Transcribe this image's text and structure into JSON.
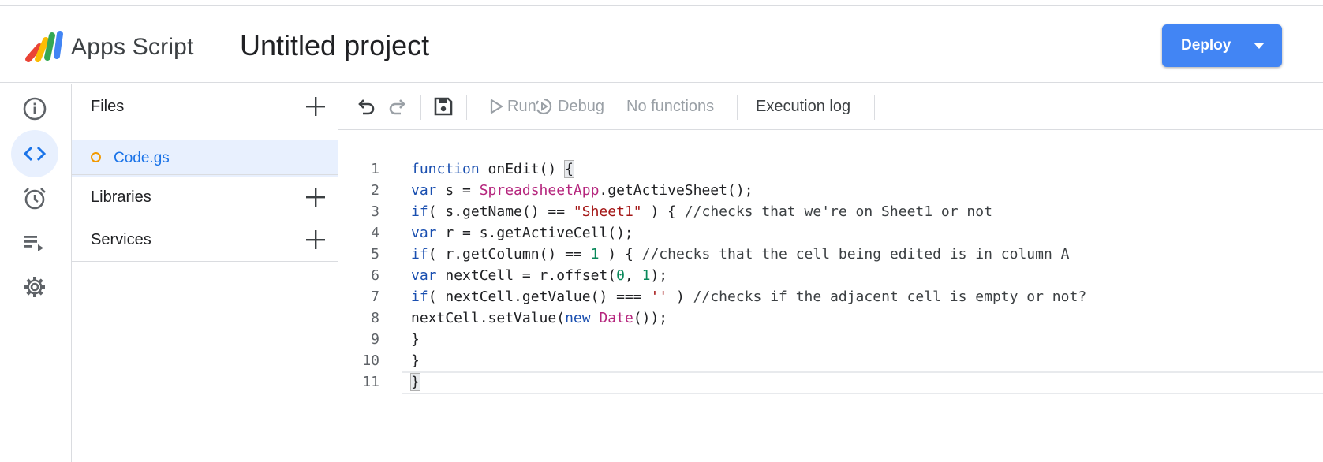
{
  "header": {
    "app_name": "Apps Script",
    "project_title": "Untitled project",
    "deploy_label": "Deploy"
  },
  "rail": {
    "items": [
      {
        "icon": "info-icon",
        "active": false
      },
      {
        "icon": "code-icon",
        "active": true
      },
      {
        "icon": "alarm-clock-icon",
        "active": false
      },
      {
        "icon": "executions-icon",
        "active": false
      },
      {
        "icon": "gear-icon",
        "active": false
      }
    ]
  },
  "files_panel": {
    "files_title": "Files",
    "files": [
      {
        "name": "Code.gs"
      }
    ],
    "libraries_title": "Libraries",
    "services_title": "Services"
  },
  "toolbar": {
    "run_label": "Run",
    "debug_label": "Debug",
    "function_select": "No functions",
    "execution_log_label": "Execution log"
  },
  "editor": {
    "line_numbers": [
      "1",
      "2",
      "3",
      "4",
      "5",
      "6",
      "7",
      "8",
      "9",
      "10",
      "11"
    ],
    "lines": [
      "function onEdit() {",
      "var s = SpreadsheetApp.getActiveSheet();",
      "if( s.getName() == \"Sheet1\" ) { //checks that we're on Sheet1 or not",
      "var r = s.getActiveCell();",
      "if( r.getColumn() == 1 ) { //checks that the cell being edited is in column A",
      "var nextCell = r.offset(0, 1);",
      "if( nextCell.getValue() === '' ) //checks if the adjacent cell is empty or not?",
      "nextCell.setValue(new Date());",
      "}",
      "}",
      "}"
    ]
  },
  "colors": {
    "accent": "#4285f4",
    "link": "#1a73e8",
    "keyword": "#1a4fb0",
    "class_name": "#b5257d",
    "string": "#a31515",
    "number": "#09885a"
  }
}
